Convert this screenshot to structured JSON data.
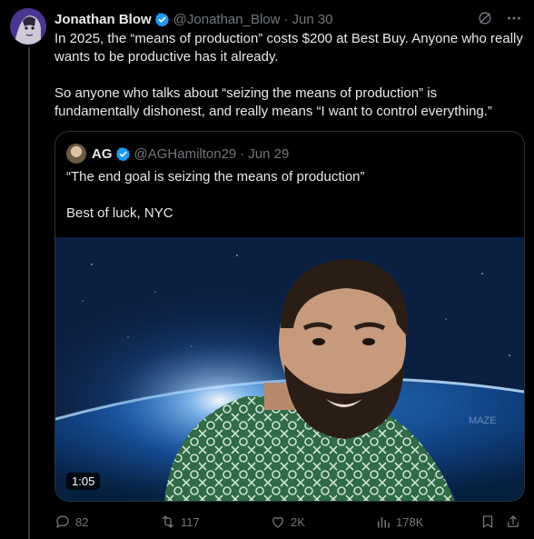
{
  "tweet": {
    "author_name": "Jonathan Blow",
    "author_handle": "@Jonathan_Blow",
    "separator": "·",
    "time": "Jun 30",
    "paragraphs": [
      "In 2025, the “means of production” costs $200 at Best Buy. Anyone who really wants to be productive has it already.",
      "So anyone who talks about “seizing the means of production” is fundamentally dishonest, and really means “I want to control everything.”"
    ],
    "icons": [
      "grok-icon",
      "more-icon"
    ]
  },
  "quote": {
    "author_name": "AG",
    "author_handle": "@AGHamilton29",
    "separator": "·",
    "time": "Jun 29",
    "paragraphs": [
      "“The end goal is seizing the means of production”",
      "Best of luck, NYC"
    ],
    "video_duration": "1:05",
    "video_watermark": "MAZE"
  },
  "actions": {
    "replies": "82",
    "reposts": "117",
    "likes": "2K",
    "views": "178K"
  },
  "colors": {
    "background": "#000000",
    "text": "#e7e9ea",
    "muted": "#71767b",
    "verified": "#1d9bf0",
    "border": "#2f3336"
  }
}
